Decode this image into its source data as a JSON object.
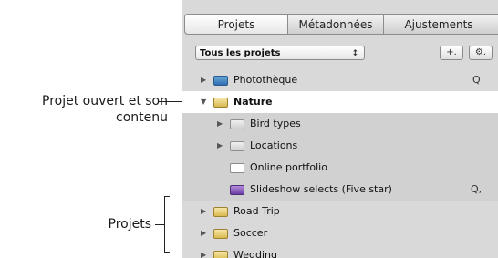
{
  "callouts": {
    "open_project": "Projet ouvert et son\ncontenu",
    "projects": "Projets"
  },
  "tabs": [
    {
      "label": "Projets"
    },
    {
      "label": "Métadonnées"
    },
    {
      "label": "Ajustements"
    }
  ],
  "toolbar": {
    "select_value": "Tous les projets",
    "select_arrows": "↕",
    "add_label": "+.",
    "gear_label": "⚙."
  },
  "list": [
    {
      "label": "Photothèque"
    },
    {
      "label": "Nature"
    },
    {
      "label": "Bird types"
    },
    {
      "label": "Locations"
    },
    {
      "label": "Online portfolio"
    },
    {
      "label": "Slideshow selects (Five star)"
    },
    {
      "label": "Road Trip"
    },
    {
      "label": "Soccer"
    },
    {
      "label": "Wedding"
    }
  ],
  "icons": {
    "disclosure_closed": "▶",
    "disclosure_open": "▼",
    "search": "🔍"
  }
}
